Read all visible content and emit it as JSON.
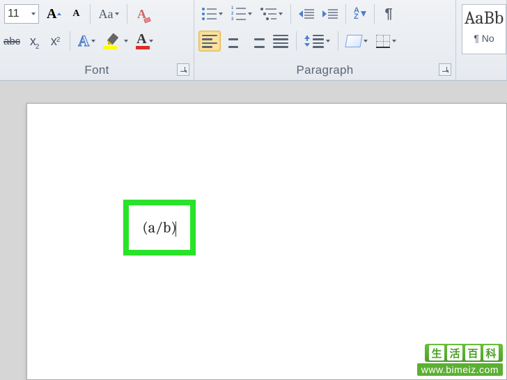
{
  "ribbon": {
    "font_group": {
      "label": "Font",
      "font_size": "11",
      "grow_font": "A",
      "shrink_font": "A",
      "change_case": "Aa",
      "strike_label": "abc",
      "subscript_base": "x",
      "subscript_sub": "2",
      "superscript_base": "x",
      "superscript_sup": "2",
      "text_effects": "A",
      "highlighter_color": "#ffff00",
      "font_color": "#d93025",
      "font_color_letter": "A"
    },
    "paragraph_group": {
      "label": "Paragraph",
      "sort_letters": "A\nZ",
      "paragraph_mark": "¶"
    },
    "styles_group": {
      "sample": "AaBb",
      "name": "¶ No"
    }
  },
  "document": {
    "callout_text": "(a/b)"
  },
  "watermark": {
    "chars": [
      "生",
      "活",
      "百",
      "科"
    ],
    "url": "www.bimeiz.com"
  }
}
